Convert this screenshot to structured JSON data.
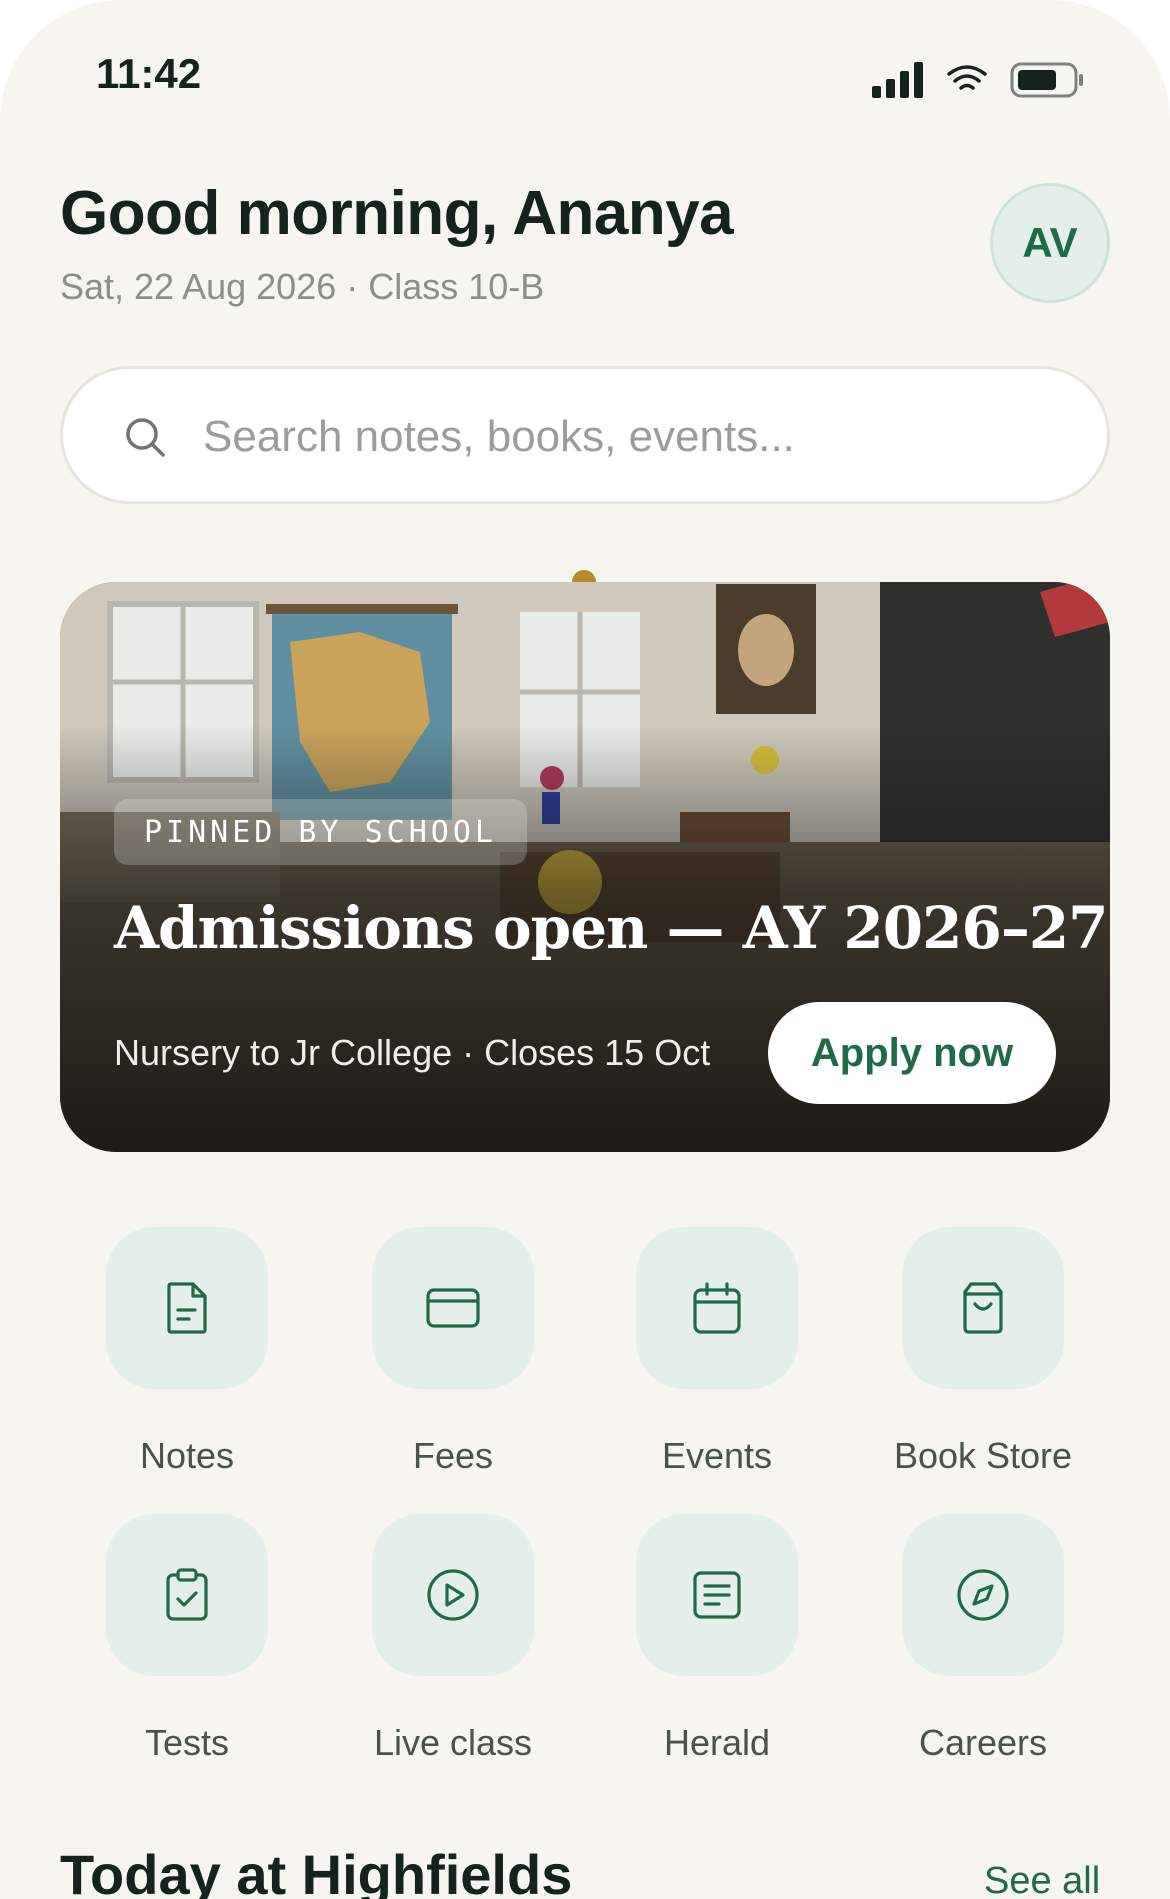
{
  "status_bar": {
    "time": "11:42"
  },
  "greeting": {
    "title": "Good morning, Ananya",
    "subtitle": "Sat, 22 Aug 2026 · Class 10-B",
    "avatar_initials": "AV"
  },
  "search": {
    "placeholder": "Search notes, books, events..."
  },
  "hero": {
    "tag": "PINNED BY SCHOOL",
    "title": "Admissions open — AY 2026–27",
    "subtitle": "Nursery to Jr College · Closes 15 Oct",
    "button_label": "Apply now"
  },
  "quick_actions": [
    {
      "label": "Notes",
      "icon": "document-icon"
    },
    {
      "label": "Fees",
      "icon": "card-icon"
    },
    {
      "label": "Events",
      "icon": "calendar-icon"
    },
    {
      "label": "Book Store",
      "icon": "shopping-bag-icon"
    },
    {
      "label": "Tests",
      "icon": "clipboard-check-icon"
    },
    {
      "label": "Live class",
      "icon": "play-circle-icon"
    },
    {
      "label": "Herald",
      "icon": "newspaper-icon"
    },
    {
      "label": "Careers",
      "icon": "compass-icon"
    }
  ],
  "today": {
    "title": "Today at Highfields",
    "see_all": "See all"
  },
  "colors": {
    "accent": "#1f6a47",
    "tile_bg": "#e4efe9",
    "background": "#f6f5f0",
    "dot": "#b68a2e"
  }
}
